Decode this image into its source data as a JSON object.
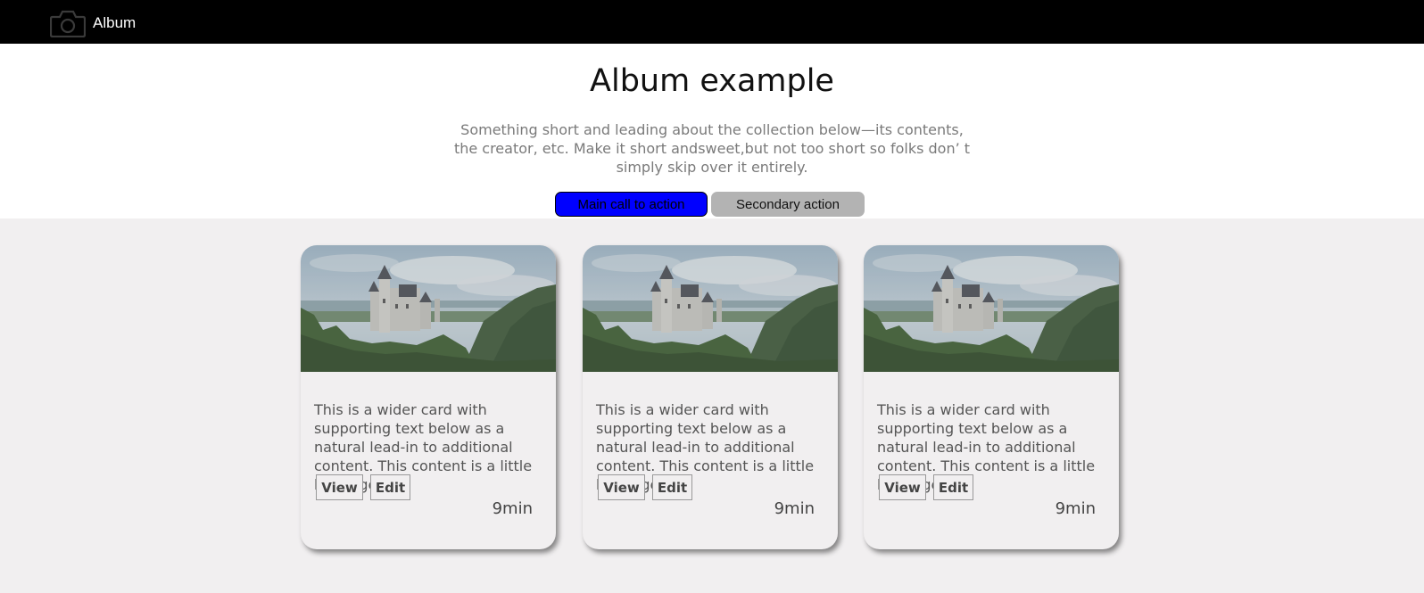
{
  "navbar": {
    "brand_icon": "camera-icon",
    "brand_label": "Album"
  },
  "hero": {
    "title": "Album example",
    "lead": "Something short and leading about the collection below—its contents, the creator, etc. Make it short andsweet,but not too short so folks don’ t simply skip over it entirely.",
    "primary_label": "Main call to action",
    "secondary_label": "Secondary action",
    "primary_color": "#0000ff",
    "secondary_color": "#b3b3b3"
  },
  "cards": [
    {
      "image": "castle-landscape-photo",
      "text": "This is a wider card with supporting text below as a natural lead-in to additional content. This content is a little bit longer.",
      "view_label": "View",
      "edit_label": "Edit",
      "time": "9min"
    },
    {
      "image": "castle-landscape-photo",
      "text": "This is a wider card with supporting text below as a natural lead-in to additional content. This content is a little bit longer.",
      "view_label": "View",
      "edit_label": "Edit",
      "time": "9min"
    },
    {
      "image": "castle-landscape-photo",
      "text": "This is a wider card with supporting text below as a natural lead-in to additional content. This content is a little bit longer.",
      "view_label": "View",
      "edit_label": "Edit",
      "time": "9min"
    }
  ]
}
